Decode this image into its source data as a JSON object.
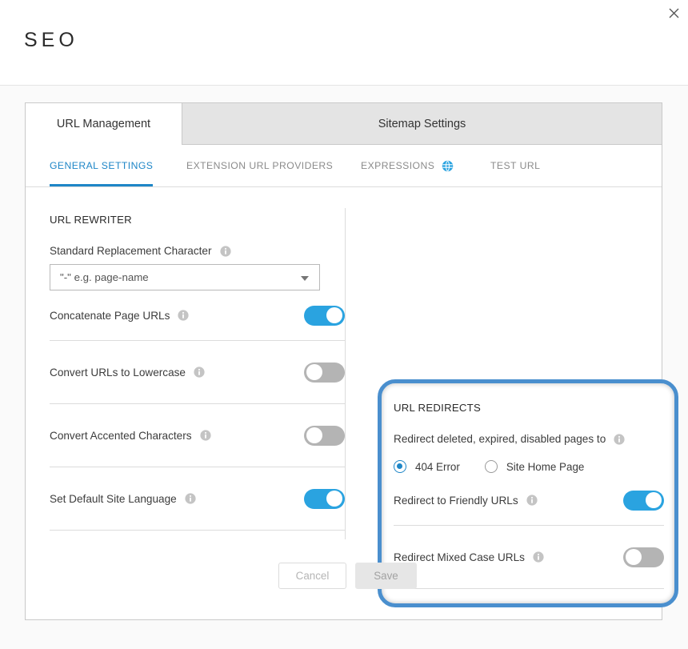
{
  "window": {
    "title": "SEO",
    "close_icon": "close-icon"
  },
  "primary_tabs": [
    {
      "label": "URL Management",
      "active": true
    },
    {
      "label": "Sitemap Settings",
      "active": false
    }
  ],
  "secondary_tabs": [
    {
      "label": "GENERAL SETTINGS",
      "active": true,
      "icon": null
    },
    {
      "label": "EXTENSION URL PROVIDERS",
      "active": false,
      "icon": null
    },
    {
      "label": "EXPRESSIONS",
      "active": false,
      "icon": "globe-icon"
    },
    {
      "label": "TEST URL",
      "active": false,
      "icon": null
    }
  ],
  "url_rewriter": {
    "section_title": "URL REWRITER",
    "replacement_character": {
      "label": "Standard Replacement Character",
      "value": "\"-\" e.g. page-name",
      "info_icon": "info-icon",
      "caret_icon": "chevron-down-icon"
    },
    "toggles": [
      {
        "label": "Concatenate Page URLs",
        "state": "on",
        "info_icon": "info-icon"
      },
      {
        "label": "Convert URLs to Lowercase",
        "state": "off",
        "info_icon": "info-icon"
      },
      {
        "label": "Convert Accented Characters",
        "state": "off",
        "info_icon": "info-icon"
      },
      {
        "label": "Set Default Site Language",
        "state": "on",
        "info_icon": "info-icon"
      }
    ]
  },
  "url_redirects": {
    "section_title": "URL REDIRECTS",
    "highlighted": true,
    "highlight_color": "#4a8fce",
    "redirect_deleted": {
      "label": "Redirect deleted, expired, disabled pages to",
      "info_icon": "info-icon",
      "options": [
        {
          "label": "404 Error",
          "selected": true
        },
        {
          "label": "Site Home Page",
          "selected": false
        }
      ]
    },
    "toggles": [
      {
        "label": "Redirect to Friendly URLs",
        "state": "on",
        "info_icon": "info-icon"
      },
      {
        "label": "Redirect Mixed Case URLs",
        "state": "off",
        "info_icon": "info-icon"
      }
    ]
  },
  "footer": {
    "cancel_label": "Cancel",
    "save_label": "Save",
    "cancel_disabled": true,
    "save_disabled": true
  },
  "colors": {
    "accent_blue": "#1e86c7",
    "toggle_on": "#2aa3e0",
    "toggle_off": "#b4b4b4",
    "highlight_ring": "#4a8fce"
  }
}
